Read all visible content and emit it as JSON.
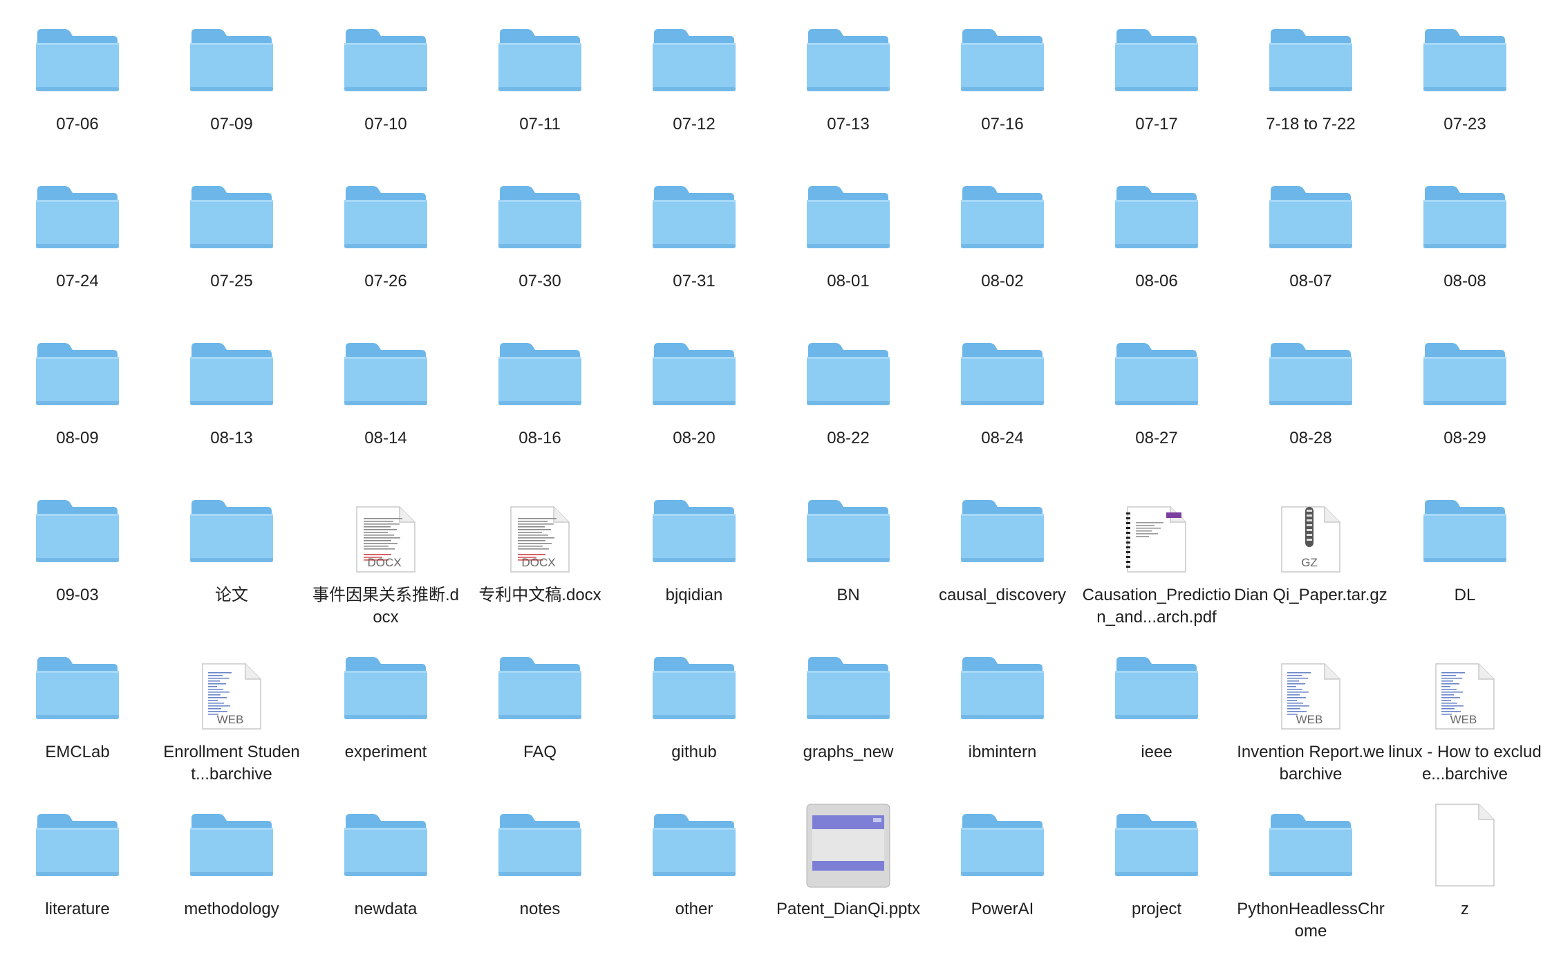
{
  "colors": {
    "folder_front": "#8dccf3",
    "folder_back": "#6cb6e9",
    "folder_tab": "#5fa9df",
    "doc_bg": "#ffffff",
    "doc_border": "#c9c9c9",
    "label_text": "#1f1f1f"
  },
  "items": [
    {
      "name": "07-06",
      "kind": "folder"
    },
    {
      "name": "07-09",
      "kind": "folder"
    },
    {
      "name": "07-10",
      "kind": "folder"
    },
    {
      "name": "07-11",
      "kind": "folder"
    },
    {
      "name": "07-12",
      "kind": "folder"
    },
    {
      "name": "07-13",
      "kind": "folder"
    },
    {
      "name": "07-16",
      "kind": "folder"
    },
    {
      "name": "07-17",
      "kind": "folder"
    },
    {
      "name": "7-18 to 7-22",
      "kind": "folder"
    },
    {
      "name": "07-23",
      "kind": "folder"
    },
    {
      "name": "07-24",
      "kind": "folder"
    },
    {
      "name": "07-25",
      "kind": "folder"
    },
    {
      "name": "07-26",
      "kind": "folder"
    },
    {
      "name": "07-30",
      "kind": "folder"
    },
    {
      "name": "07-31",
      "kind": "folder"
    },
    {
      "name": "08-01",
      "kind": "folder"
    },
    {
      "name": "08-02",
      "kind": "folder"
    },
    {
      "name": "08-06",
      "kind": "folder"
    },
    {
      "name": "08-07",
      "kind": "folder"
    },
    {
      "name": "08-08",
      "kind": "folder"
    },
    {
      "name": "08-09",
      "kind": "folder"
    },
    {
      "name": "08-13",
      "kind": "folder"
    },
    {
      "name": "08-14",
      "kind": "folder"
    },
    {
      "name": "08-16",
      "kind": "folder"
    },
    {
      "name": "08-20",
      "kind": "folder"
    },
    {
      "name": "08-22",
      "kind": "folder"
    },
    {
      "name": "08-24",
      "kind": "folder"
    },
    {
      "name": "08-27",
      "kind": "folder"
    },
    {
      "name": "08-28",
      "kind": "folder"
    },
    {
      "name": "08-29",
      "kind": "folder"
    },
    {
      "name": "09-03",
      "kind": "folder"
    },
    {
      "name": "论文",
      "kind": "folder"
    },
    {
      "name": "事件因果关系推断.docx",
      "kind": "doc",
      "badge": "DOCX"
    },
    {
      "name": "专利中文稿.docx",
      "kind": "doc",
      "badge": "DOCX"
    },
    {
      "name": "bjqidian",
      "kind": "folder"
    },
    {
      "name": "BN",
      "kind": "folder"
    },
    {
      "name": "causal_discovery",
      "kind": "folder"
    },
    {
      "name": "Causation_Prediction_and...arch.pdf",
      "kind": "pdf",
      "badge": ""
    },
    {
      "name": "Dian Qi_Paper.tar.gz",
      "kind": "gz",
      "badge": "GZ"
    },
    {
      "name": "DL",
      "kind": "folder"
    },
    {
      "name": "EMCLab",
      "kind": "folder"
    },
    {
      "name": "Enrollment Student...barchive",
      "kind": "web",
      "badge": "WEB"
    },
    {
      "name": "experiment",
      "kind": "folder"
    },
    {
      "name": "FAQ",
      "kind": "folder"
    },
    {
      "name": "github",
      "kind": "folder"
    },
    {
      "name": "graphs_new",
      "kind": "folder"
    },
    {
      "name": "ibmintern",
      "kind": "folder"
    },
    {
      "name": "ieee",
      "kind": "folder"
    },
    {
      "name": "Invention Report.webarchive",
      "kind": "web",
      "badge": "WEB"
    },
    {
      "name": "linux - How to exclude...barchive",
      "kind": "web",
      "badge": "WEB"
    },
    {
      "name": "literature",
      "kind": "folder"
    },
    {
      "name": "methodology",
      "kind": "folder"
    },
    {
      "name": "newdata",
      "kind": "folder"
    },
    {
      "name": "notes",
      "kind": "folder"
    },
    {
      "name": "other",
      "kind": "folder"
    },
    {
      "name": "Patent_DianQi.pptx",
      "kind": "pptx"
    },
    {
      "name": "PowerAI",
      "kind": "folder"
    },
    {
      "name": "project",
      "kind": "folder"
    },
    {
      "name": "PythonHeadlessChrome",
      "kind": "folder"
    },
    {
      "name": "z",
      "kind": "blank"
    }
  ]
}
